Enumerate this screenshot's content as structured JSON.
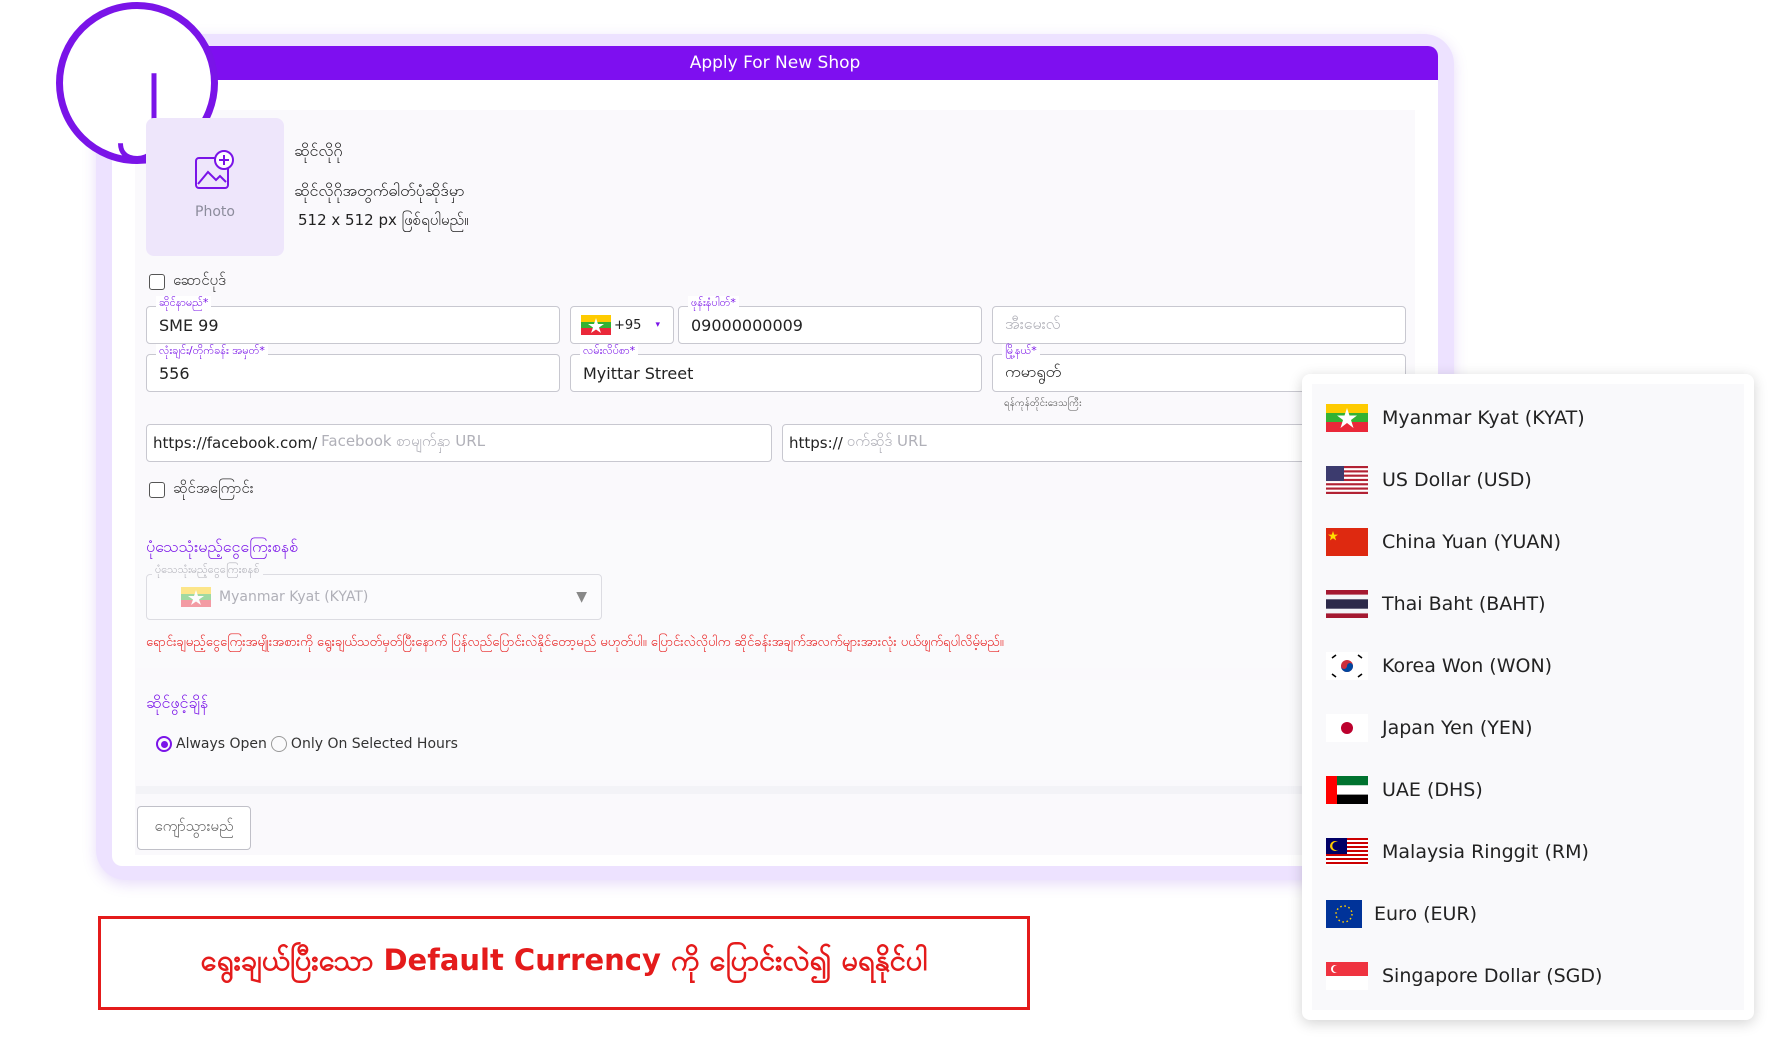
{
  "step_badge": "၂",
  "window": {
    "title": "Apply For New Shop"
  },
  "photo": {
    "label": "Photo",
    "title": "ဆိုင်လိုဂို",
    "desc_line1": "ဆိုင်လိုဂိုအတွက်ဓါတ်ပုံဆိုဒ်မှာ",
    "desc_line2": "512 x 512 px ဖြစ်ရပါမည်။"
  },
  "cover_checkbox": "ဆောင်ပုဒ်",
  "shop_name": {
    "label": "ဆိုင်နာမည်*",
    "value": "SME 99"
  },
  "phone": {
    "code": "+95",
    "label": "ဖုန်းနံပါတ်*",
    "value": "09000000009"
  },
  "email": {
    "placeholder": "အီးမေးလ်"
  },
  "house_no": {
    "label": "လုံးချင်း/တိုက်ခန်း အမှတ်*",
    "value": "556"
  },
  "street": {
    "label": "လမ်းလိပ်စာ*",
    "value": "Myittar Street"
  },
  "township": {
    "label": "မြို့နယ်*",
    "value": "ကမာရွတ်",
    "hint": "ရန်ကုန်တိုင်းဒေသကြီး"
  },
  "facebook": {
    "prefix": "https://facebook.com/",
    "placeholder": "Facebook စာမျက်နှာ URL"
  },
  "website": {
    "prefix": "https://",
    "placeholder": "ဝက်ဆိုဒ် URL"
  },
  "about_checkbox": "ဆိုင်အကြောင်း",
  "currency": {
    "section_title": "ပုံသေသုံးမည့်ငွေကြေးစနစ်",
    "field_label": "ပုံသေသုံးမည့်ငွေကြေးစနစ်",
    "selected": "Myanmar Kyat (KYAT)",
    "warning": "ရောင်းချမည့်ငွေကြေးအမျိုးအစားကို ရွေးချယ်သတ်မှတ်ပြီးနောက် ပြန်လည်ပြောင်းလဲနိုင်တော့မည် မဟုတ်ပါ။ ပြောင်းလဲလိုပါက ဆိုင်ခန်းအချက်အလက်များအားလုံး ပယ်ဖျက်ရပါလိမ့်မည်။",
    "options": [
      {
        "label": "Myanmar Kyat (KYAT)",
        "flag": "mm-flag"
      },
      {
        "label": "US Dollar (USD)",
        "flag": "us-flag"
      },
      {
        "label": "China Yuan (YUAN)",
        "flag": "cn-flag"
      },
      {
        "label": "Thai Baht (BAHT)",
        "flag": "th-flag"
      },
      {
        "label": "Korea Won (WON)",
        "flag": "kr-flag"
      },
      {
        "label": "Japan Yen (YEN)",
        "flag": "jp-flag"
      },
      {
        "label": "UAE (DHS)",
        "flag": "ae-flag"
      },
      {
        "label": "Malaysia Ringgit (RM)",
        "flag": "my-flag"
      },
      {
        "label": "Euro (EUR)",
        "flag": "eu-flag"
      },
      {
        "label": "Singapore Dollar (SGD)",
        "flag": "sg-flag"
      }
    ]
  },
  "opening": {
    "section_title": "ဆိုင်ဖွင့်ချိန်",
    "always_open": "Always Open",
    "selected_hours": "Only On Selected Hours"
  },
  "back_button": "ကျော်သွားမည်",
  "callout": "ရွေးချယ်ပြီးသော Default Currency ကို ပြောင်းလဲ၍ မရနိုင်ပါ",
  "colors": {
    "accent": "#7e0ff0",
    "warning": "#e81f1f"
  }
}
